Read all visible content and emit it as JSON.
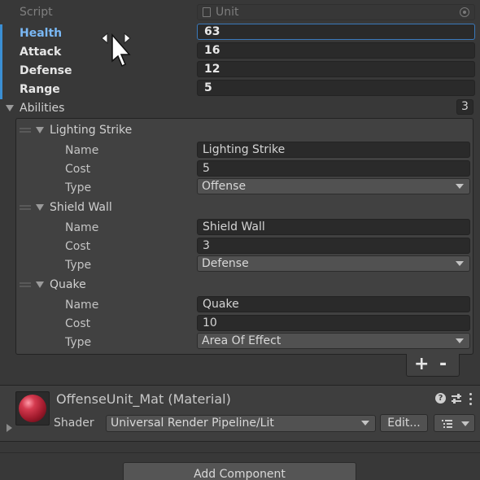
{
  "script": {
    "label": "Script",
    "value": "Unit"
  },
  "stats": [
    {
      "label": "Health",
      "value": "63"
    },
    {
      "label": "Attack",
      "value": "16"
    },
    {
      "label": "Defense",
      "value": "12"
    },
    {
      "label": "Range",
      "value": "5"
    }
  ],
  "abilities": {
    "label": "Abilities",
    "count": "3",
    "field_labels": {
      "name": "Name",
      "cost": "Cost",
      "type": "Type"
    },
    "items": [
      {
        "header": "Lighting Strike",
        "name": "Lighting Strike",
        "cost": "5",
        "type": "Offense"
      },
      {
        "header": "Shield Wall",
        "name": "Shield Wall",
        "cost": "3",
        "type": "Defense"
      },
      {
        "header": "Quake",
        "name": "Quake",
        "cost": "10",
        "type": "Area Of Effect"
      }
    ],
    "add_label": "+",
    "remove_label": "-"
  },
  "material": {
    "title": "OffenseUnit_Mat (Material)",
    "shader_label": "Shader",
    "shader_value": "Universal Render Pipeline/Lit",
    "edit_label": "Edit...",
    "swatch_color": "#c0283b"
  },
  "add_component_label": "Add Component",
  "colors": {
    "accent": "#3b8fd4",
    "background": "#383838",
    "field": "#2a2a2a"
  }
}
